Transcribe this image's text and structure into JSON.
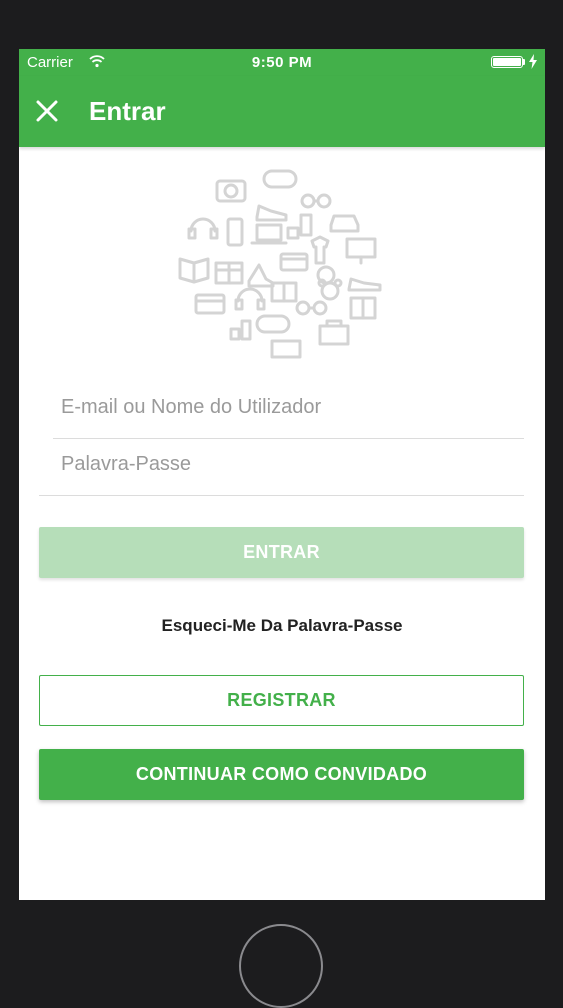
{
  "status_bar": {
    "carrier": "Carrier",
    "time": "9:50 PM"
  },
  "app_bar": {
    "title": "Entrar",
    "close_icon": "close-icon"
  },
  "illustration": {
    "icon": "shopping-categories-icon-cluster"
  },
  "form": {
    "email_placeholder": "E-mail ou Nome do Utilizador",
    "email_value": "",
    "password_placeholder": "Palavra-Passe",
    "password_value": ""
  },
  "actions": {
    "login_label": "ENTRAR",
    "forgot_label": "Esqueci-Me Da Palavra-Passe",
    "register_label": "REGISTRAR",
    "guest_label": "CONTINUAR COMO CONVIDADO"
  },
  "colors": {
    "accent": "#43b04a",
    "accent_disabled": "#b6deb9",
    "background": "#ffffff",
    "device": "#1c1c1e"
  }
}
